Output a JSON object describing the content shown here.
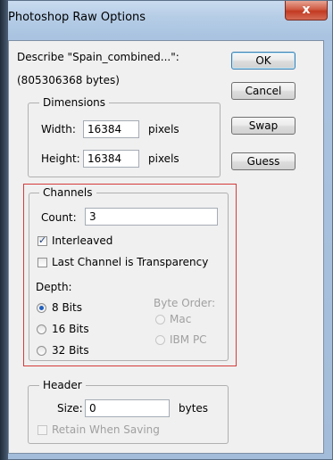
{
  "window": {
    "title": "Photoshop Raw Options",
    "close_glyph": "x"
  },
  "header": {
    "describe": "Describe \"Spain_combined...\":",
    "bytes": "(805306368 bytes)"
  },
  "buttons": {
    "ok": "OK",
    "cancel": "Cancel",
    "swap": "Swap",
    "guess": "Guess"
  },
  "dimensions": {
    "legend": "Dimensions",
    "width_label": "Width:",
    "width_value": "16384",
    "width_unit": "pixels",
    "height_label": "Height:",
    "height_value": "16384",
    "height_unit": "pixels"
  },
  "channels": {
    "legend": "Channels",
    "count_label": "Count:",
    "count_value": "3",
    "interleaved_label": "Interleaved",
    "interleaved_checked": true,
    "last_channel_label": "Last Channel is Transparency",
    "last_channel_checked": false,
    "depth_label": "Depth:",
    "depth_options": [
      "8 Bits",
      "16 Bits",
      "32 Bits"
    ],
    "depth_selected": "8 Bits",
    "byte_order_label": "Byte Order:",
    "byte_order_options": [
      "Mac",
      "IBM PC"
    ]
  },
  "header_group": {
    "legend": "Header",
    "size_label": "Size:",
    "size_value": "0",
    "size_unit": "bytes",
    "retain_label": "Retain When Saving",
    "retain_checked": false
  },
  "colors": {
    "highlight": "#d63a3a",
    "close_button": "#c23a22",
    "radio_selected": "#1f5fbf"
  }
}
